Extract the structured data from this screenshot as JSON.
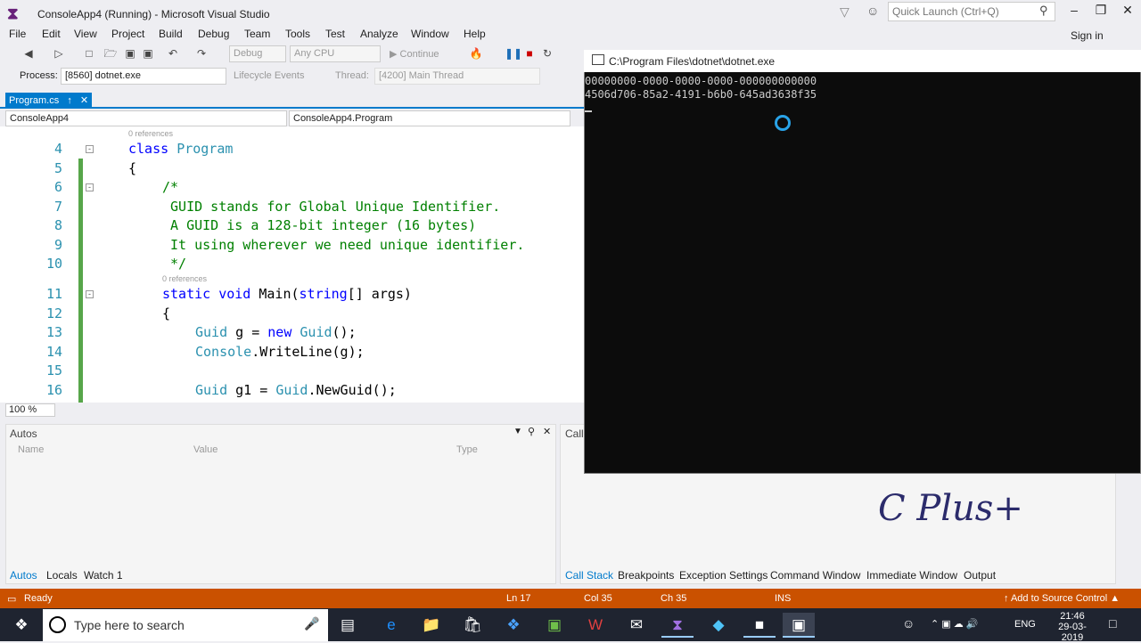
{
  "window": {
    "title": "ConsoleApp4 (Running) - Microsoft Visual Studio",
    "quick_launch_placeholder": "Quick Launch (Ctrl+Q)",
    "sign_in": "Sign in"
  },
  "menu": [
    "File",
    "Edit",
    "View",
    "Project",
    "Build",
    "Debug",
    "Team",
    "Tools",
    "Test",
    "Analyze",
    "Window",
    "Help"
  ],
  "toolbar": {
    "config": "Debug",
    "platform": "Any CPU",
    "continue": "Continue",
    "process_label": "Process:",
    "process_value": "[8560] dotnet.exe",
    "lifecycle": "Lifecycle Events",
    "thread_label": "Thread:",
    "thread_value": "[4200] Main Thread"
  },
  "editor": {
    "tab": "Program.cs",
    "nav_project": "ConsoleApp4",
    "nav_class": "ConsoleApp4.Program",
    "refs_class": "0 references",
    "refs_main": "0 references",
    "zoom": "100 %",
    "line_numbers": [
      "4",
      "5",
      "6",
      "7",
      "8",
      "9",
      "10",
      "11",
      "12",
      "13",
      "14",
      "15",
      "16"
    ],
    "code": {
      "l4_kw": "class",
      "l4_name": "Program",
      "l5": "{",
      "l6": "/*",
      "l7": " GUID stands for Global Unique Identifier.",
      "l8": " A GUID is a 128-bit integer (16 bytes)",
      "l9": " It using wherever we need unique identifier.",
      "l10": " */",
      "l11_kw1": "static",
      "l11_kw2": "void",
      "l11_rest": " Main(",
      "l11_kw3": "string",
      "l11_end": "[] args)",
      "l12": "{",
      "l13_ty": "Guid",
      "l13_mid": " g = ",
      "l13_kw": "new",
      "l13_ty2": "Guid",
      "l13_end": "();",
      "l14_ty": "Console",
      "l14_end": ".WriteLine(g);",
      "l16_ty": "Guid",
      "l16_mid": " g1 = ",
      "l16_ty2": "Guid",
      "l16_end": ".NewGuid();"
    }
  },
  "console": {
    "title": "C:\\Program Files\\dotnet\\dotnet.exe",
    "lines": [
      "00000000-0000-0000-0000-000000000000",
      "4506d706-85a2-4191-b6b0-645ad3638f35"
    ]
  },
  "autos": {
    "title": "Autos",
    "cols": [
      "Name",
      "Value",
      "Type"
    ],
    "tabs": [
      "Autos",
      "Locals",
      "Watch 1"
    ]
  },
  "callstack": {
    "title": "Call",
    "tabs": [
      "Call Stack",
      "Breakpoints",
      "Exception Settings",
      "Command Window",
      "Immediate Window",
      "Output"
    ]
  },
  "brand": "C Plus+",
  "status": {
    "ready": "Ready",
    "ln": "Ln 17",
    "col": "Col 35",
    "ch": "Ch 35",
    "ins": "INS",
    "source_control": "Add to Source Control"
  },
  "taskbar": {
    "search": "Type here to search",
    "time": "21:46",
    "date": "29-03-2019",
    "lang": "ENG"
  },
  "colors": {
    "accent": "#007acc",
    "status": "#ca5100",
    "console_bg": "#0c0c0c"
  }
}
